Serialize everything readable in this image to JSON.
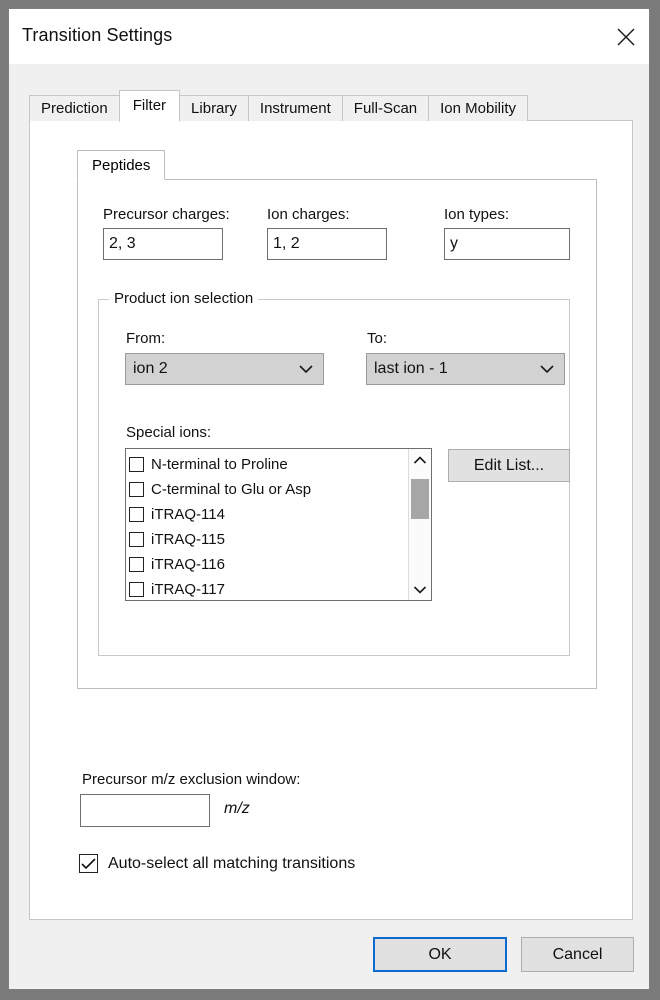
{
  "window": {
    "title": "Transition Settings",
    "close_icon": "close-icon"
  },
  "tabs": [
    {
      "label": "Prediction",
      "selected": false
    },
    {
      "label": "Filter",
      "selected": true
    },
    {
      "label": "Library",
      "selected": false
    },
    {
      "label": "Instrument",
      "selected": false
    },
    {
      "label": "Full-Scan",
      "selected": false
    },
    {
      "label": "Ion Mobility",
      "selected": false
    }
  ],
  "filter_tab": {
    "inner_tabs": [
      {
        "label": "Peptides",
        "selected": true
      }
    ],
    "fields": {
      "precursor_charges": {
        "label": "Precursor charges:",
        "value": "2, 3"
      },
      "ion_charges": {
        "label": "Ion charges:",
        "value": "1, 2"
      },
      "ion_types": {
        "label": "Ion types:",
        "value": "y"
      }
    },
    "product_ion_selection": {
      "title": "Product ion selection",
      "from": {
        "label": "From:",
        "value": "ion 2"
      },
      "to": {
        "label": "To:",
        "value": "last ion - 1"
      },
      "special_ions": {
        "label": "Special ions:",
        "items": [
          {
            "label": "N-terminal to Proline",
            "checked": false
          },
          {
            "label": "C-terminal to Glu or Asp",
            "checked": false
          },
          {
            "label": "iTRAQ-114",
            "checked": false
          },
          {
            "label": "iTRAQ-115",
            "checked": false
          },
          {
            "label": "iTRAQ-116",
            "checked": false
          },
          {
            "label": "iTRAQ-117",
            "checked": false
          }
        ],
        "edit_list_button": "Edit List..."
      }
    },
    "exclusion_window": {
      "label": "Precursor m/z exclusion window:",
      "value": "",
      "placeholder": "",
      "suffix": "m/z"
    },
    "auto_select": {
      "label": "Auto-select all matching transitions",
      "checked": true
    }
  },
  "footer": {
    "ok_label": "OK",
    "cancel_label": "Cancel"
  },
  "colors": {
    "accent": "#0b6bd1",
    "dialog_bg": "#f0f0f0",
    "panel_bg": "#ffffff",
    "button_bg": "#e1e1e1",
    "combo_bg": "#d2d2d2",
    "scroll_thumb": "#a6a6a6"
  }
}
